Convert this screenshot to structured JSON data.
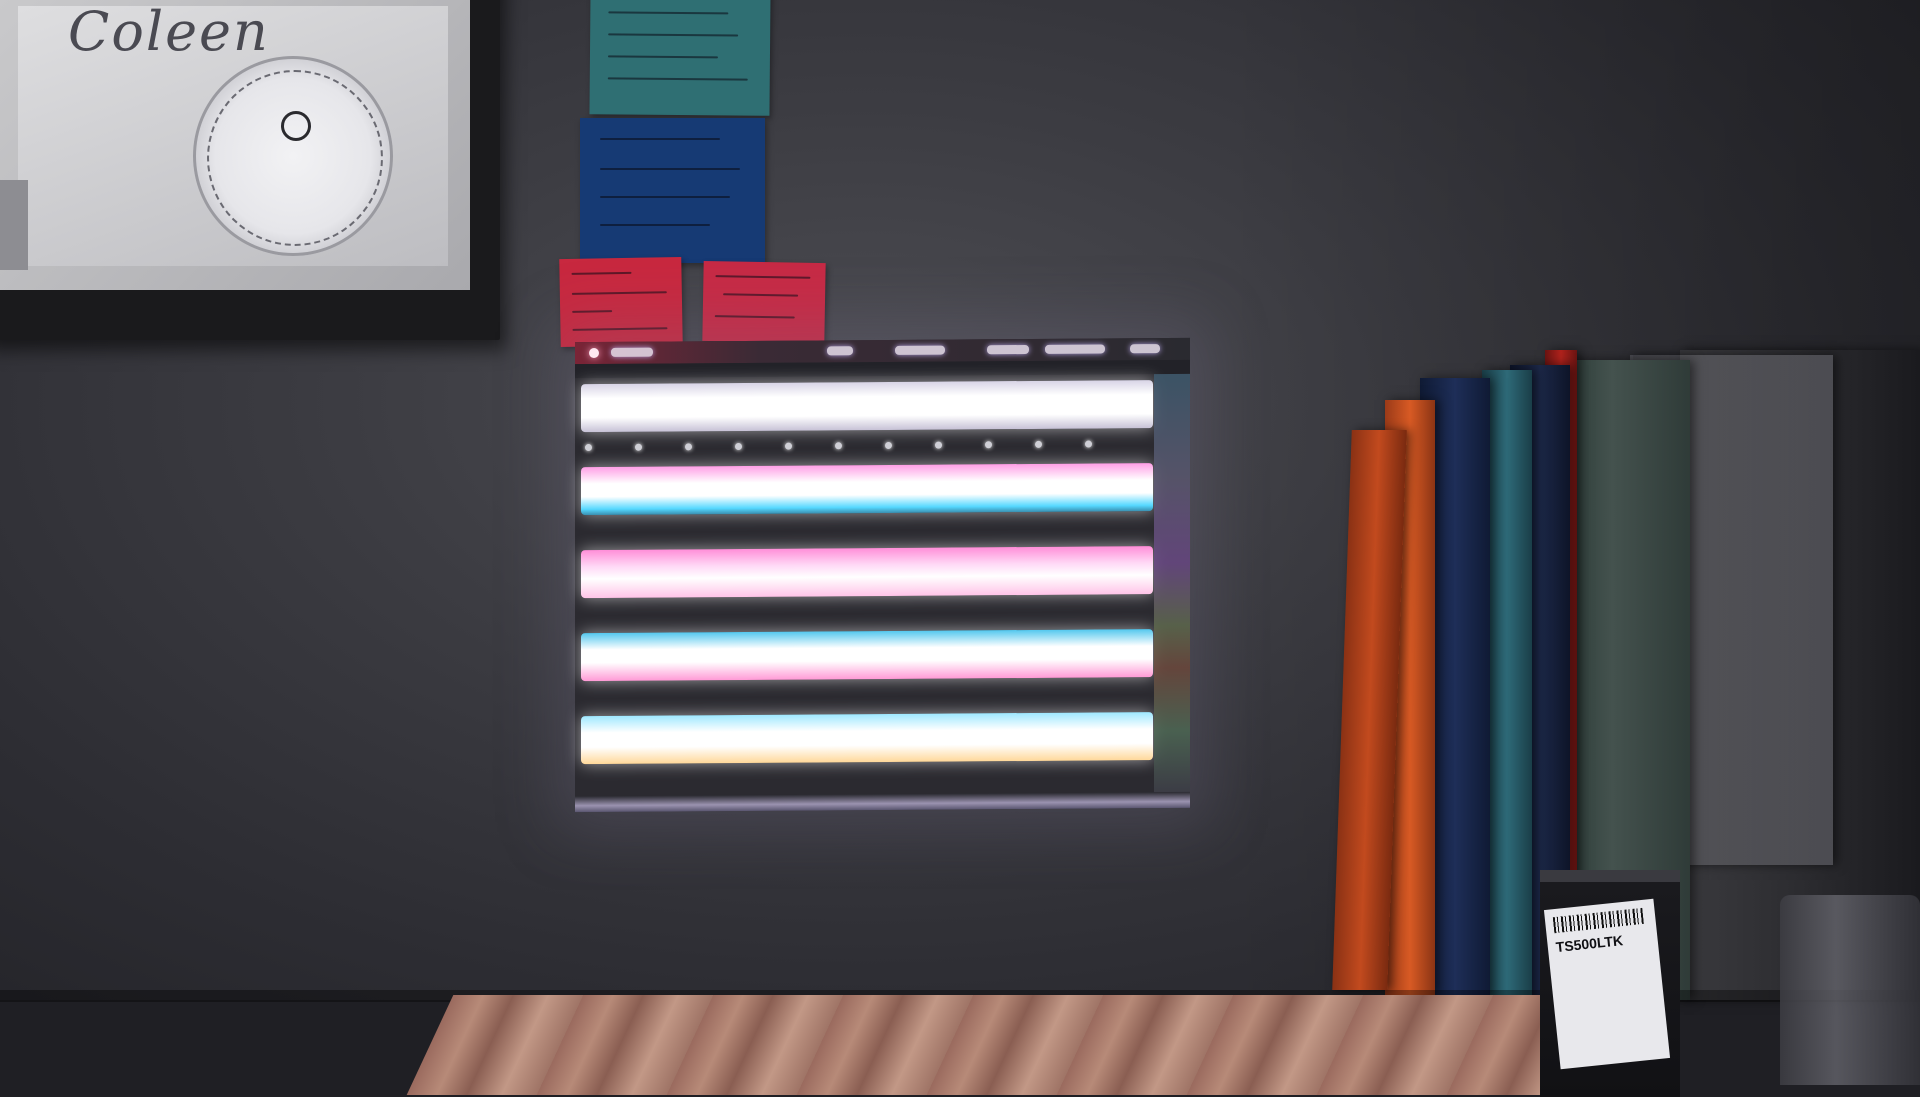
{
  "scene": {
    "description_tag": "photo",
    "box_label": "TS500LTK",
    "frame_handwriting": "Coleen"
  },
  "colors": {
    "wall": "#3c3c42",
    "sticky_teal": "#2f6f73",
    "sticky_blue": "#163a74",
    "sticky_red": "#c8283f",
    "binder_orange": "#c24a1e",
    "binder_navy": "#1e2e58"
  },
  "icons": {
    "dial": "circular-slide-rule-icon"
  }
}
